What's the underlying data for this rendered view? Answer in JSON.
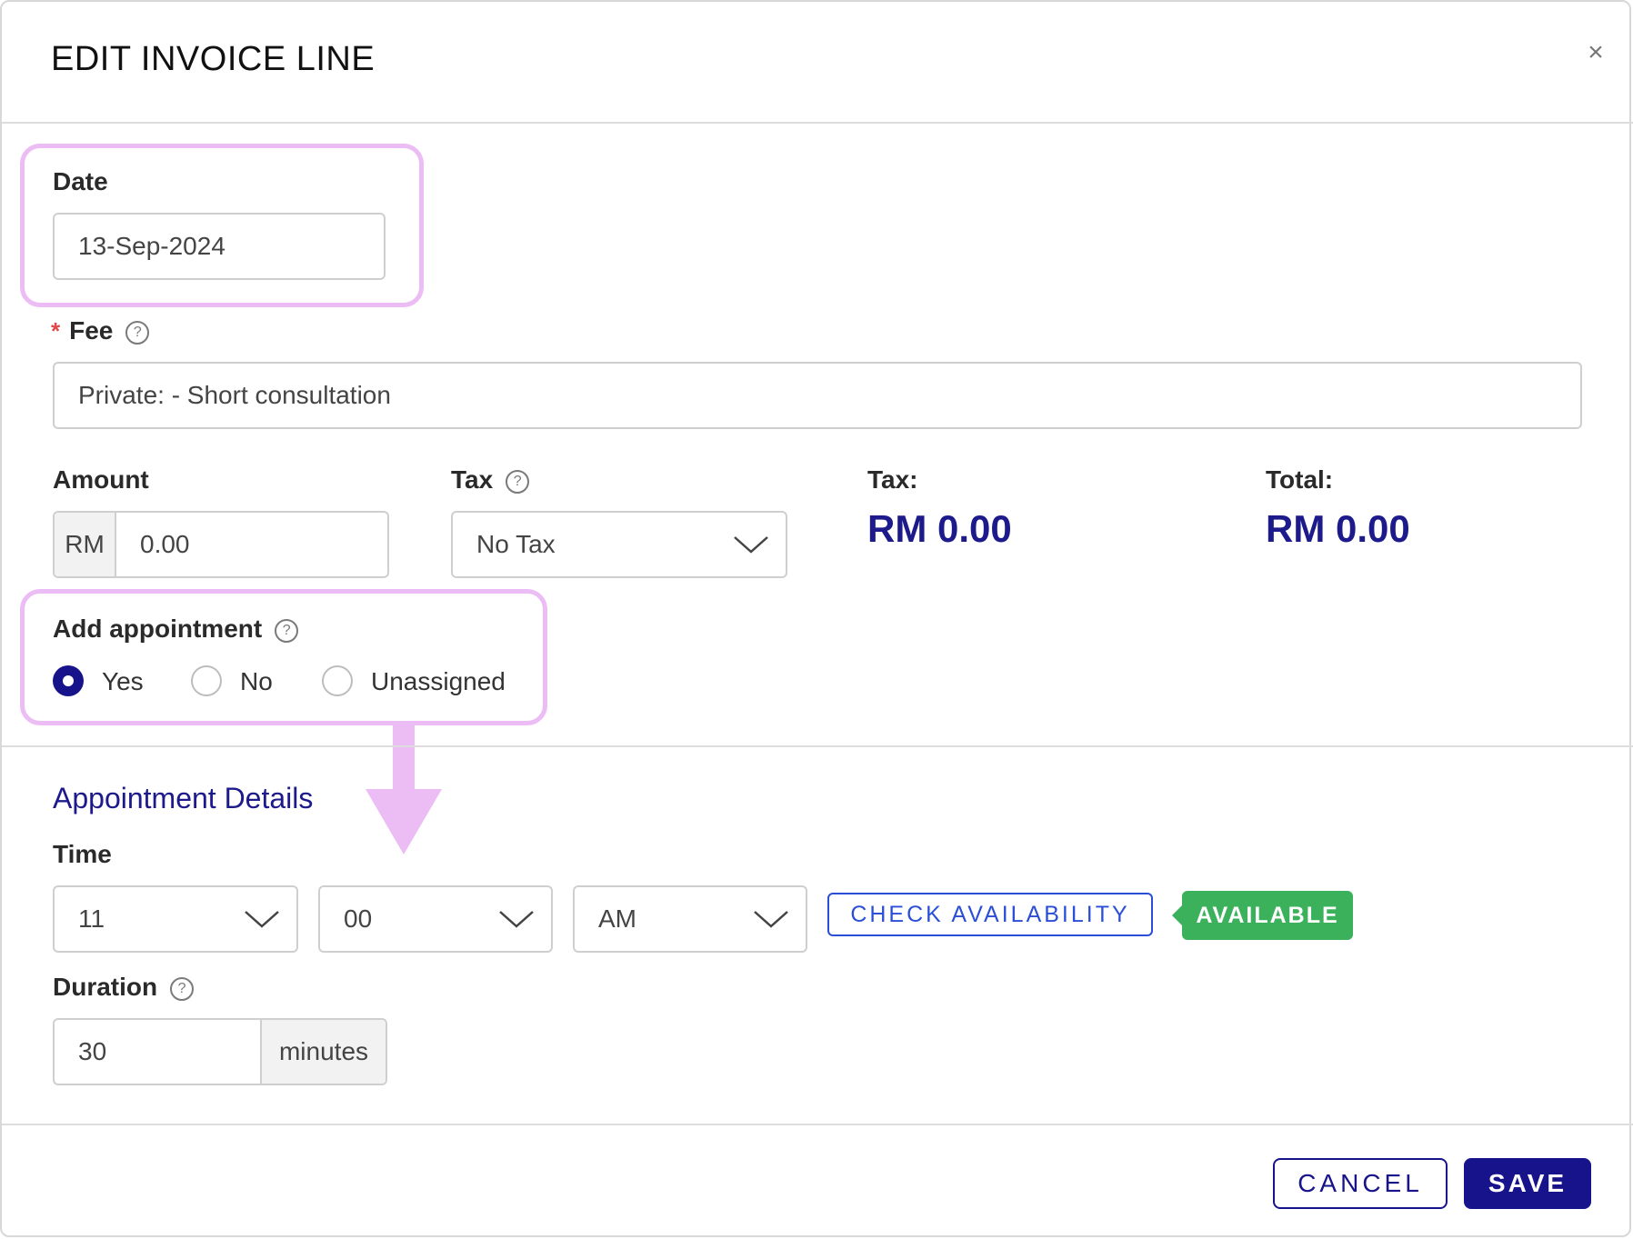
{
  "dialog": {
    "title": "EDIT INVOICE LINE",
    "close_symbol": "×"
  },
  "date": {
    "label": "Date",
    "value": "13-Sep-2024"
  },
  "fee": {
    "required_mark": "*",
    "label": "Fee",
    "value": "Private:  - Short consultation"
  },
  "amount": {
    "label": "Amount",
    "currency": "RM",
    "value": "0.00"
  },
  "tax_select": {
    "label": "Tax",
    "selected": "No Tax"
  },
  "tax_total": {
    "label": "Tax:",
    "value": "RM 0.00"
  },
  "grand_total": {
    "label": "Total:",
    "value": "RM 0.00"
  },
  "add_appointment": {
    "label": "Add appointment",
    "options": [
      {
        "label": "Yes",
        "checked": true
      },
      {
        "label": "No",
        "checked": false
      },
      {
        "label": "Unassigned",
        "checked": false
      }
    ]
  },
  "appointment_details": {
    "heading": "Appointment Details",
    "time_label": "Time",
    "hour": "11",
    "minute": "00",
    "meridiem": "AM",
    "check_button": "CHECK AVAILABILITY",
    "status_badge": "AVAILABLE",
    "duration_label": "Duration",
    "duration_value": "30",
    "duration_unit": "minutes"
  },
  "footer": {
    "cancel_label": "CANCEL",
    "save_label": "SAVE"
  },
  "colors": {
    "accent": "#17138a",
    "highlight": "#ecbcf5",
    "success": "#3bb15c",
    "link": "#2a4fd6"
  },
  "icons": [
    "close-icon",
    "help-icon",
    "chevron-down-icon",
    "arrow-down-icon"
  ]
}
